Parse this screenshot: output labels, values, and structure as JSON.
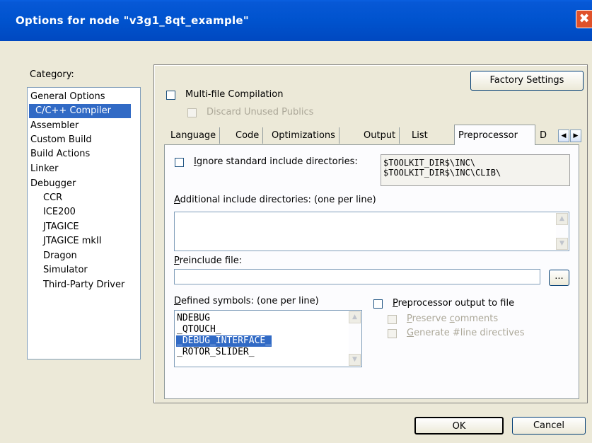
{
  "window": {
    "title": "Options for node \"v3g1_8qt_example\"",
    "close_glyph": "✖"
  },
  "category": {
    "label": "Category:",
    "items": [
      {
        "label": "General Options"
      },
      {
        "label": "C/C++ Compiler",
        "selected": true
      },
      {
        "label": "Assembler"
      },
      {
        "label": "Custom Build"
      },
      {
        "label": "Build Actions"
      },
      {
        "label": "Linker"
      },
      {
        "label": "Debugger"
      },
      {
        "label": "CCR"
      },
      {
        "label": "ICE200"
      },
      {
        "label": "JTAGICE"
      },
      {
        "label": "JTAGICE mkII"
      },
      {
        "label": "Dragon"
      },
      {
        "label": "Simulator"
      },
      {
        "label": "Third-Party Driver"
      }
    ]
  },
  "buttons": {
    "factory": "Factory Settings",
    "ok": "OK",
    "cancel": "Cancel",
    "browse": "..."
  },
  "multi_file": {
    "label": "Multi-file Compilation",
    "checked": false
  },
  "discard": {
    "label": "Discard Unused Publics",
    "checked": false,
    "disabled": true
  },
  "tabs": {
    "items": [
      {
        "label": "Language"
      },
      {
        "label": "Code"
      },
      {
        "label": "Optimizations"
      },
      {
        "label": "Output"
      },
      {
        "label": "List"
      },
      {
        "label": "Preprocessor",
        "active": true
      },
      {
        "label": "D"
      }
    ],
    "scroll_left": "◀",
    "scroll_right": "▶"
  },
  "preprocessor": {
    "ignore_std_first": "I",
    "ignore_std_rest": "gnore standard include directories:",
    "std_dirs": [
      "$TOOLKIT_DIR$\\INC\\",
      "$TOOLKIT_DIR$\\INC\\CLIB\\"
    ],
    "additional_first": "A",
    "additional_rest": "dditional include directories: (one per line)",
    "additional_value": "",
    "preinclude_first": "P",
    "preinclude_rest": "reinclude file:",
    "preinclude_value": "",
    "defined_first": "D",
    "defined_rest": "efined symbols: (one per line)",
    "symbols": [
      "NDEBUG",
      "_QTOUCH_",
      "_DEBUG_INTERFACE_",
      "_ROTOR_SLIDER_"
    ],
    "selected_symbol_index": 2,
    "pp_output_first": "P",
    "pp_output_rest": "reprocessor output to file",
    "preserve_first": "P",
    "preserve_mid": "reserve ",
    "preserve_c": "c",
    "preserve_rest": "omments",
    "gen_first": "G",
    "gen_rest": "enerate #line directives"
  },
  "scroll_icons": {
    "up": "▲",
    "down": "▼"
  }
}
